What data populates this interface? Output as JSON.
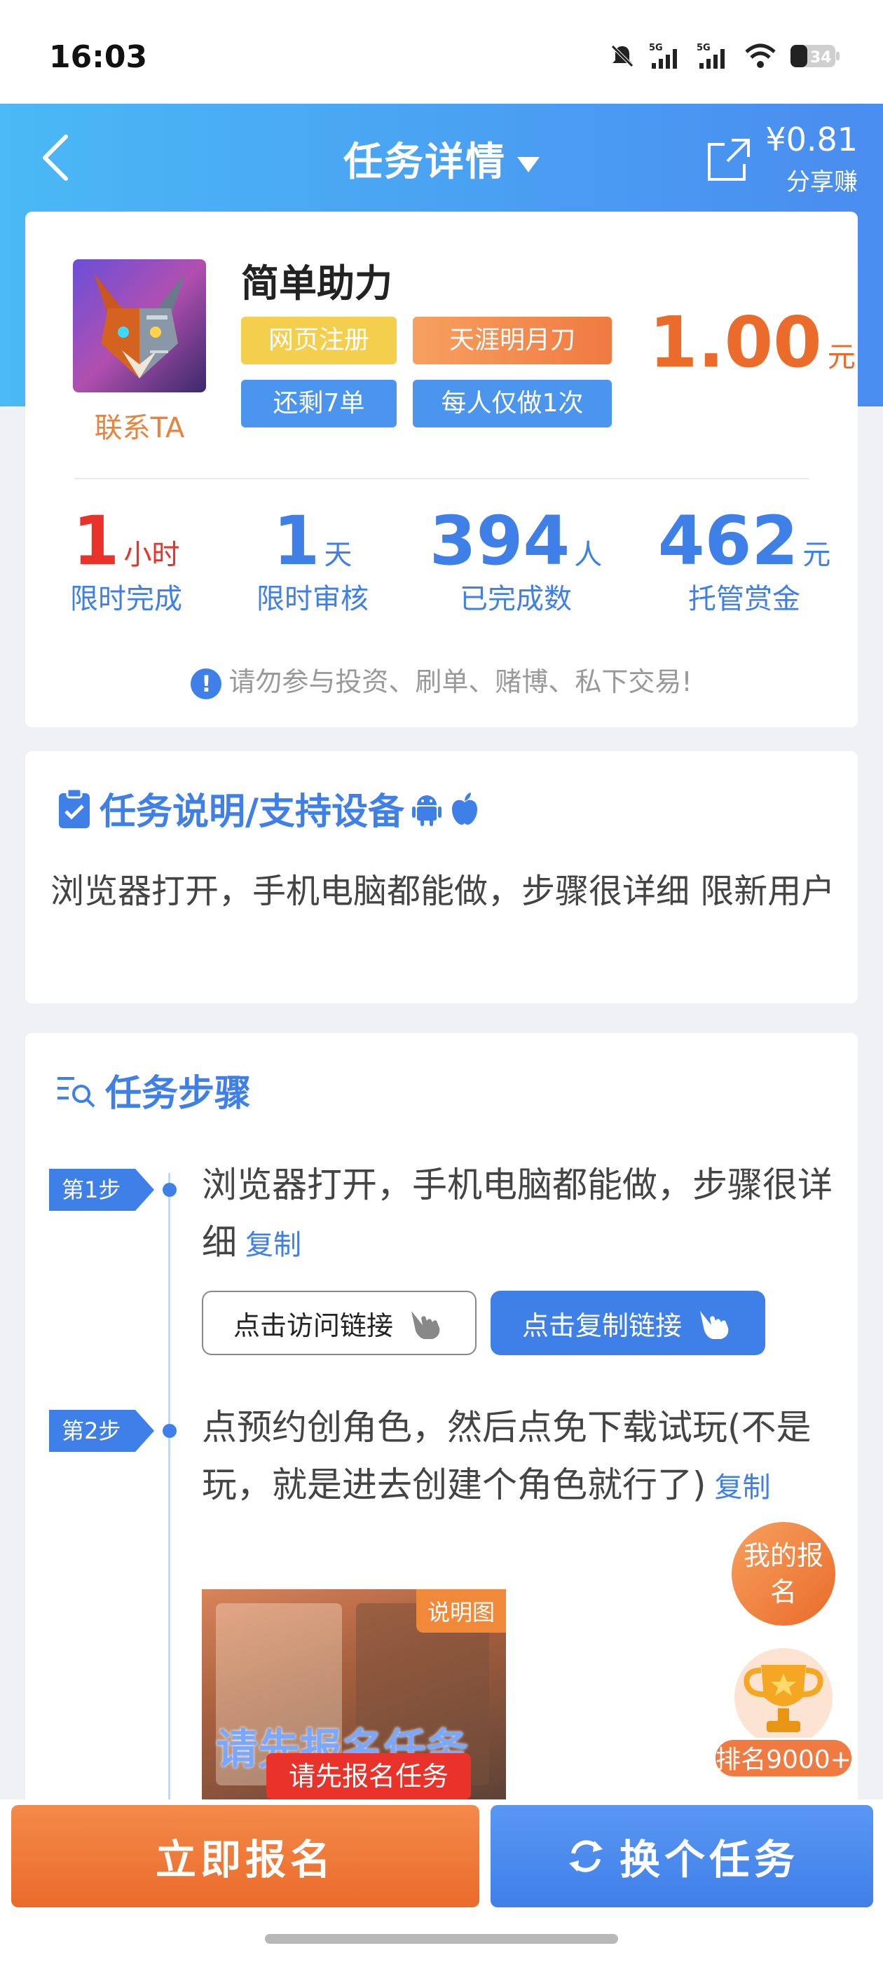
{
  "status_bar": {
    "time": "16:03",
    "battery": "34",
    "signal1": "5G",
    "signal2": "5G"
  },
  "header": {
    "title": "任务详情",
    "share_amount": "¥0.81",
    "share_label": "分享赚"
  },
  "task": {
    "name": "简单助力",
    "contact": "联系TA",
    "tags": [
      "网页注册",
      "天涯明月刀",
      "还剩7单",
      "每人仅做1次"
    ],
    "price": "1.00",
    "price_unit": "元",
    "stats": [
      {
        "value": "1",
        "unit": "小时",
        "label": "限时完成"
      },
      {
        "value": "1",
        "unit": "天",
        "label": "限时审核"
      },
      {
        "value": "394",
        "unit": "人",
        "label": "已完成数"
      },
      {
        "value": "462",
        "unit": "元",
        "label": "托管赏金"
      }
    ],
    "warning": "请勿参与投资、刷单、赌博、私下交易!"
  },
  "description": {
    "title": "任务说明/支持设备",
    "text": "浏览器打开，手机电脑都能做，步骤很详细 限新用户"
  },
  "steps": {
    "title": "任务步骤",
    "items": [
      {
        "badge": "第1步",
        "text": "浏览器打开，手机电脑都能做，步骤很详细",
        "copy": "复制"
      },
      {
        "badge": "第2步",
        "text": "点预约创角色，然后点免下载试玩(不是玩，就是进去创建个角色就行了)",
        "copy": "复制"
      }
    ],
    "visit_button": "点击访问链接",
    "copy_button": "点击复制链接",
    "illustration_tag": "说明图",
    "illustration_text": "请先报名任务"
  },
  "floating": {
    "my_signup": "我的报名",
    "rank": "排名9000+"
  },
  "bottom": {
    "tooltip": "请先报名任务",
    "signup_button": "立即报名",
    "switch_button": "换个任务"
  },
  "colors": {
    "accent_blue": "#3f7fe8",
    "accent_orange": "#ea6b2a",
    "red": "#e8322a",
    "header_gradient_start": "#4ab9f5",
    "header_gradient_end": "#4a8cf0"
  }
}
